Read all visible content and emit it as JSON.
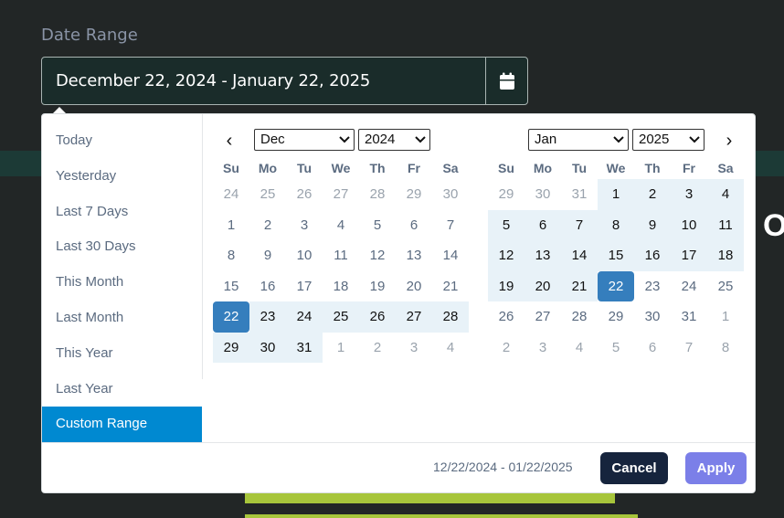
{
  "field": {
    "label": "Date Range",
    "value": "December 22, 2024 - January 22, 2025",
    "button_icon": "calendar-icon"
  },
  "ranges": [
    {
      "label": "Today",
      "active": false
    },
    {
      "label": "Yesterday",
      "active": false
    },
    {
      "label": "Last 7 Days",
      "active": false
    },
    {
      "label": "Last 30 Days",
      "active": false
    },
    {
      "label": "This Month",
      "active": false
    },
    {
      "label": "Last Month",
      "active": false
    },
    {
      "label": "This Year",
      "active": false
    },
    {
      "label": "Last Year",
      "active": false
    },
    {
      "label": "Custom Range",
      "active": true
    }
  ],
  "weekdays": [
    "Su",
    "Mo",
    "Tu",
    "We",
    "Th",
    "Fr",
    "Sa"
  ],
  "calendars": {
    "left": {
      "month": "Dec",
      "year": "2024",
      "nav": "‹",
      "weeks": [
        [
          {
            "d": "24",
            "s": "off"
          },
          {
            "d": "25",
            "s": "off"
          },
          {
            "d": "26",
            "s": "off"
          },
          {
            "d": "27",
            "s": "off"
          },
          {
            "d": "28",
            "s": "off"
          },
          {
            "d": "29",
            "s": "off"
          },
          {
            "d": "30",
            "s": "off"
          }
        ],
        [
          {
            "d": "1",
            "s": ""
          },
          {
            "d": "2",
            "s": ""
          },
          {
            "d": "3",
            "s": ""
          },
          {
            "d": "4",
            "s": ""
          },
          {
            "d": "5",
            "s": ""
          },
          {
            "d": "6",
            "s": ""
          },
          {
            "d": "7",
            "s": ""
          }
        ],
        [
          {
            "d": "8",
            "s": ""
          },
          {
            "d": "9",
            "s": ""
          },
          {
            "d": "10",
            "s": ""
          },
          {
            "d": "11",
            "s": ""
          },
          {
            "d": "12",
            "s": ""
          },
          {
            "d": "13",
            "s": ""
          },
          {
            "d": "14",
            "s": ""
          }
        ],
        [
          {
            "d": "15",
            "s": ""
          },
          {
            "d": "16",
            "s": ""
          },
          {
            "d": "17",
            "s": ""
          },
          {
            "d": "18",
            "s": ""
          },
          {
            "d": "19",
            "s": ""
          },
          {
            "d": "20",
            "s": ""
          },
          {
            "d": "21",
            "s": ""
          }
        ],
        [
          {
            "d": "22",
            "s": "sel-end"
          },
          {
            "d": "23",
            "s": "inrange"
          },
          {
            "d": "24",
            "s": "inrange"
          },
          {
            "d": "25",
            "s": "inrange"
          },
          {
            "d": "26",
            "s": "inrange"
          },
          {
            "d": "27",
            "s": "inrange"
          },
          {
            "d": "28",
            "s": "inrange"
          }
        ],
        [
          {
            "d": "29",
            "s": "inrange"
          },
          {
            "d": "30",
            "s": "inrange"
          },
          {
            "d": "31",
            "s": "inrange"
          },
          {
            "d": "1",
            "s": "off"
          },
          {
            "d": "2",
            "s": "off"
          },
          {
            "d": "3",
            "s": "off"
          },
          {
            "d": "4",
            "s": "off"
          }
        ]
      ]
    },
    "right": {
      "month": "Jan",
      "year": "2025",
      "nav": "›",
      "weeks": [
        [
          {
            "d": "29",
            "s": "off"
          },
          {
            "d": "30",
            "s": "off"
          },
          {
            "d": "31",
            "s": "off"
          },
          {
            "d": "1",
            "s": "inrange"
          },
          {
            "d": "2",
            "s": "inrange"
          },
          {
            "d": "3",
            "s": "inrange"
          },
          {
            "d": "4",
            "s": "inrange"
          }
        ],
        [
          {
            "d": "5",
            "s": "inrange"
          },
          {
            "d": "6",
            "s": "inrange"
          },
          {
            "d": "7",
            "s": "inrange"
          },
          {
            "d": "8",
            "s": "inrange"
          },
          {
            "d": "9",
            "s": "inrange"
          },
          {
            "d": "10",
            "s": "inrange"
          },
          {
            "d": "11",
            "s": "inrange"
          }
        ],
        [
          {
            "d": "12",
            "s": "inrange"
          },
          {
            "d": "13",
            "s": "inrange"
          },
          {
            "d": "14",
            "s": "inrange"
          },
          {
            "d": "15",
            "s": "inrange"
          },
          {
            "d": "16",
            "s": "inrange"
          },
          {
            "d": "17",
            "s": "inrange"
          },
          {
            "d": "18",
            "s": "inrange"
          }
        ],
        [
          {
            "d": "19",
            "s": "inrange"
          },
          {
            "d": "20",
            "s": "inrange"
          },
          {
            "d": "21",
            "s": "inrange"
          },
          {
            "d": "22",
            "s": "sel-end"
          },
          {
            "d": "23",
            "s": ""
          },
          {
            "d": "24",
            "s": ""
          },
          {
            "d": "25",
            "s": ""
          }
        ],
        [
          {
            "d": "26",
            "s": ""
          },
          {
            "d": "27",
            "s": ""
          },
          {
            "d": "28",
            "s": ""
          },
          {
            "d": "29",
            "s": ""
          },
          {
            "d": "30",
            "s": ""
          },
          {
            "d": "31",
            "s": ""
          },
          {
            "d": "1",
            "s": "off"
          }
        ],
        [
          {
            "d": "2",
            "s": "off"
          },
          {
            "d": "3",
            "s": "off"
          },
          {
            "d": "4",
            "s": "off"
          },
          {
            "d": "5",
            "s": "off"
          },
          {
            "d": "6",
            "s": "off"
          },
          {
            "d": "7",
            "s": "off"
          },
          {
            "d": "8",
            "s": "off"
          }
        ]
      ]
    }
  },
  "footer": {
    "selected_range": "12/22/2024 - 01/22/2025",
    "cancel_label": "Cancel",
    "apply_label": "Apply"
  },
  "background": {
    "partial_text": "O"
  },
  "colors": {
    "active_range": "#0089d1",
    "selected_day": "#357ebd",
    "in_range": "#e8f2f8",
    "cancel_button": "#16243d",
    "apply_button": "#7b7fe8"
  }
}
